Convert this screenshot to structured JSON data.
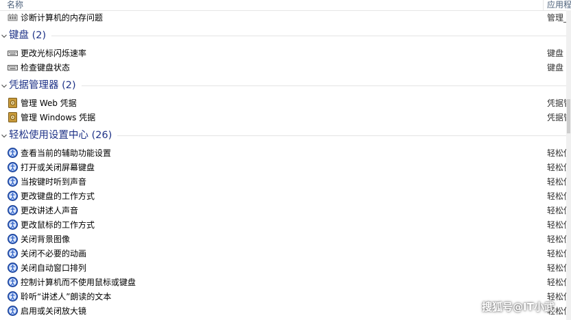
{
  "header": {
    "name": "名称",
    "app": "应用程"
  },
  "top_row": {
    "label": "诊断计算机的内存问题",
    "app": "管理_",
    "icon": "memory-chip-icon"
  },
  "groups": [
    {
      "title": "键盘 (2)",
      "icon": "keyboard-icon",
      "items": [
        {
          "label": "更改光标闪烁速率",
          "app": "键盘"
        },
        {
          "label": "检查键盘状态",
          "app": "键盘"
        }
      ]
    },
    {
      "title": "凭据管理器 (2)",
      "icon": "credential-vault-icon",
      "items": [
        {
          "label": "管理 Web 凭据",
          "app": "凭据管"
        },
        {
          "label": "管理 Windows 凭据",
          "app": "凭据管"
        }
      ]
    },
    {
      "title": "轻松使用设置中心 (26)",
      "icon": "ease-of-access-icon",
      "items": [
        {
          "label": "查看当前的辅助功能设置",
          "app": "轻松使"
        },
        {
          "label": "打开或关闭屏幕键盘",
          "app": "轻松使"
        },
        {
          "label": "当按键时听到声音",
          "app": "轻松使"
        },
        {
          "label": "更改键盘的工作方式",
          "app": "轻松使"
        },
        {
          "label": "更改讲述人声音",
          "app": "轻松使"
        },
        {
          "label": "更改鼠标的工作方式",
          "app": "轻松使"
        },
        {
          "label": "关闭背景图像",
          "app": "轻松使"
        },
        {
          "label": "关闭不必要的动画",
          "app": "轻松使"
        },
        {
          "label": "关闭自动窗口排列",
          "app": "轻松使"
        },
        {
          "label": "控制计算机而不使用鼠标或键盘",
          "app": "轻松使"
        },
        {
          "label": "聆听“讲述人”朗读的文本",
          "app": "轻松使"
        },
        {
          "label": "启用或关闭放大镜",
          "app": "轻松使"
        }
      ]
    }
  ],
  "watermark": "搜狐号@IT小武",
  "colors": {
    "group_title": "#1e3287",
    "header_text": "#4c607a",
    "divider": "#e3e3e3"
  }
}
